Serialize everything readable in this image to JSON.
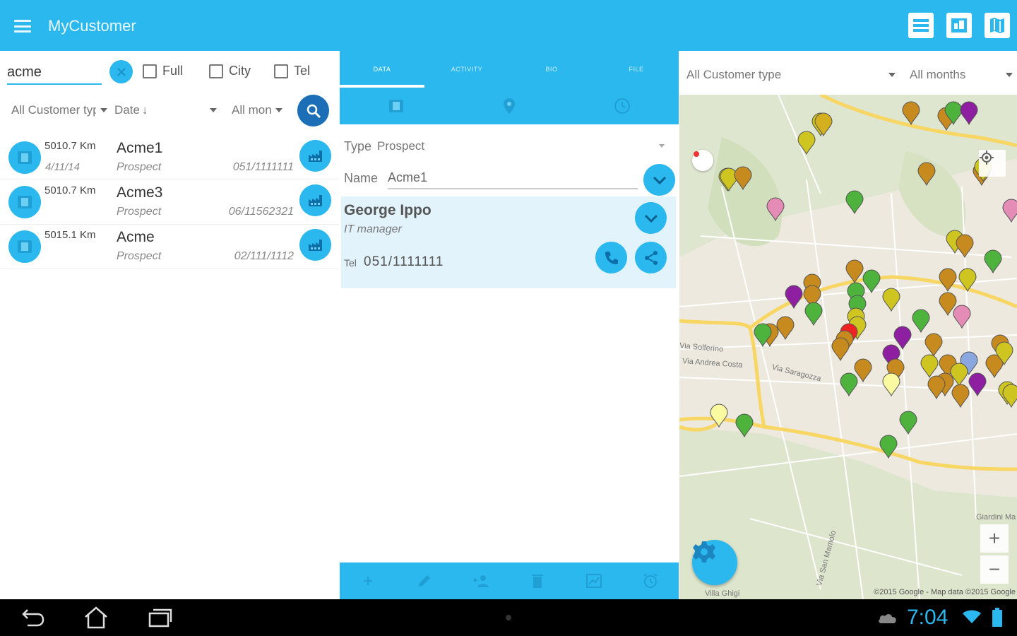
{
  "app": {
    "title": "MyCustomer"
  },
  "left": {
    "search": {
      "value": "acme"
    },
    "checks": [
      {
        "label": "Full"
      },
      {
        "label": "City"
      },
      {
        "label": "Tel"
      }
    ],
    "filters": {
      "customer_type": "All Customer type",
      "sort": "Date",
      "sort_arrow": "↓",
      "months": "All months"
    },
    "customers": [
      {
        "distance": "5010.7 Km",
        "date": "4/11/14",
        "name": "Acme1",
        "type": "Prospect",
        "phone": "051/1111111"
      },
      {
        "distance": "5010.7 Km",
        "date": "",
        "name": "Acme3",
        "type": "Prospect",
        "phone": "06/11562321"
      },
      {
        "distance": "5015.1 Km",
        "date": "",
        "name": "Acme",
        "type": "Prospect",
        "phone": "02/111/1112"
      }
    ]
  },
  "middle": {
    "tabs": [
      "DATA",
      "ACTIVITY",
      "BIO",
      "FILE"
    ],
    "type_label": "Type",
    "type_value": "Prospect",
    "name_label": "Name",
    "name_value": "Acme1",
    "contact": {
      "name": "George Ippo",
      "role": "IT manager",
      "tel_label": "Tel",
      "tel": "051/1111111"
    }
  },
  "right": {
    "filters": {
      "customer_type": "All Customer type",
      "months": "All months"
    },
    "map": {
      "copyright": "©2015 Google - Map data ©2015 Google",
      "labels": [
        "Via Solferino",
        "Via Andrea Costa",
        "Via Saragozza",
        "Giardini Ma",
        "Via San Mamolo",
        "Villa Ghigi"
      ]
    }
  },
  "system": {
    "clock": "7:04"
  },
  "colors": {
    "accent": "#2ab8ee",
    "dark_accent": "#1c6fb7"
  },
  "icons": {
    "menu": "menu-icon",
    "list_view": "list-view-icon",
    "split_view": "split-view-icon",
    "map_view": "map-view-icon",
    "clear": "close-icon",
    "search": "search-icon",
    "customer": "customer-icon",
    "factory": "factory-icon",
    "expand": "chevron-down-icon",
    "phone": "phone-icon",
    "share": "share-icon",
    "gear": "gear-icon",
    "locate": "locate-icon"
  }
}
